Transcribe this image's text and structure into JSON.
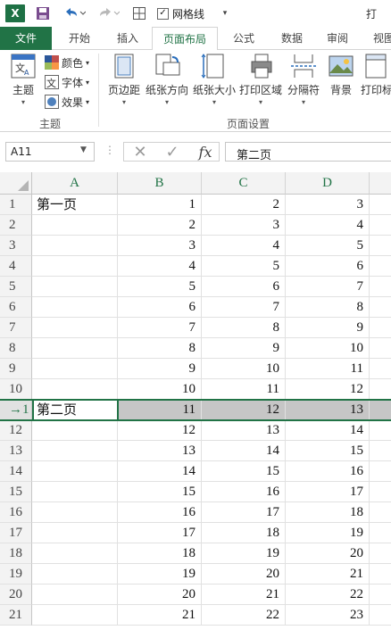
{
  "qat": {
    "app_letter": "X",
    "gridlines_label": "网格线",
    "gridlines_checked": "✓",
    "title_partial": "打"
  },
  "tabs": [
    {
      "id": "file",
      "label": "文件"
    },
    {
      "id": "home",
      "label": "开始"
    },
    {
      "id": "insert",
      "label": "插入"
    },
    {
      "id": "layout",
      "label": "页面布局"
    },
    {
      "id": "formula",
      "label": "公式"
    },
    {
      "id": "data",
      "label": "数据"
    },
    {
      "id": "review",
      "label": "审阅"
    },
    {
      "id": "view",
      "label": "视图"
    }
  ],
  "ribbon": {
    "theme": {
      "label": "主题",
      "colors": "颜色",
      "fonts": "字体",
      "effects": "效果",
      "group": "主题"
    },
    "page_setup": {
      "margins": "页边距",
      "orientation": "纸张方向",
      "size": "纸张大小",
      "print_area": "打印区域",
      "breaks": "分隔符",
      "background": "背景",
      "print_titles": "打印标",
      "group": "页面设置"
    }
  },
  "formula_bar": {
    "name_box": "A11",
    "content": "第二页",
    "fx": "fx"
  },
  "sheet": {
    "columns": [
      "A",
      "B",
      "C",
      "D"
    ],
    "active_row_header": "→1",
    "rows": [
      {
        "n": "1",
        "a": "第一页",
        "b": "1",
        "c": "2",
        "d": "3"
      },
      {
        "n": "2",
        "a": "",
        "b": "2",
        "c": "3",
        "d": "4"
      },
      {
        "n": "3",
        "a": "",
        "b": "3",
        "c": "4",
        "d": "5"
      },
      {
        "n": "4",
        "a": "",
        "b": "4",
        "c": "5",
        "d": "6"
      },
      {
        "n": "5",
        "a": "",
        "b": "5",
        "c": "6",
        "d": "7"
      },
      {
        "n": "6",
        "a": "",
        "b": "6",
        "c": "7",
        "d": "8"
      },
      {
        "n": "7",
        "a": "",
        "b": "7",
        "c": "8",
        "d": "9"
      },
      {
        "n": "8",
        "a": "",
        "b": "8",
        "c": "9",
        "d": "10"
      },
      {
        "n": "9",
        "a": "",
        "b": "9",
        "c": "10",
        "d": "11"
      },
      {
        "n": "10",
        "a": "",
        "b": "10",
        "c": "11",
        "d": "12"
      },
      {
        "n": "11",
        "a": "第二页",
        "b": "11",
        "c": "12",
        "d": "13"
      },
      {
        "n": "12",
        "a": "",
        "b": "12",
        "c": "13",
        "d": "14"
      },
      {
        "n": "13",
        "a": "",
        "b": "13",
        "c": "14",
        "d": "15"
      },
      {
        "n": "14",
        "a": "",
        "b": "14",
        "c": "15",
        "d": "16"
      },
      {
        "n": "15",
        "a": "",
        "b": "15",
        "c": "16",
        "d": "17"
      },
      {
        "n": "16",
        "a": "",
        "b": "16",
        "c": "17",
        "d": "18"
      },
      {
        "n": "17",
        "a": "",
        "b": "17",
        "c": "18",
        "d": "19"
      },
      {
        "n": "18",
        "a": "",
        "b": "18",
        "c": "19",
        "d": "20"
      },
      {
        "n": "19",
        "a": "",
        "b": "19",
        "c": "20",
        "d": "21"
      },
      {
        "n": "20",
        "a": "",
        "b": "20",
        "c": "21",
        "d": "22"
      },
      {
        "n": "21",
        "a": "",
        "b": "21",
        "c": "22",
        "d": "23"
      }
    ],
    "selected_row_index": 10
  },
  "colors": {
    "accent": "#217346",
    "selection_fill": "#c6c6c6"
  }
}
